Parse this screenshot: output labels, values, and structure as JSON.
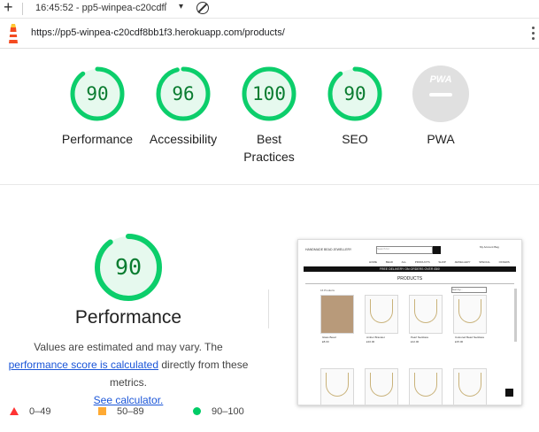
{
  "topbar": {
    "plus": "+",
    "title": "16:45:52 - pp5-winpea-c20cdfẛ",
    "caret": "▾"
  },
  "urlbar": {
    "url": "https://pp5-winpea-c20cdf8bb1f3.herokuapp.com/products/"
  },
  "categories": [
    {
      "score": "90",
      "label": "Performance",
      "value": 0.9
    },
    {
      "score": "96",
      "label": "Accessibility",
      "value": 0.96
    },
    {
      "score": "100",
      "label": "Best Practices",
      "value": 1.0
    },
    {
      "score": "90",
      "label": "SEO",
      "value": 0.9
    }
  ],
  "pwa": {
    "label": "PWA",
    "badge": "PWA"
  },
  "performance": {
    "score": "90",
    "value": 0.9,
    "title": "Performance",
    "desc_1": "Values are estimated and may vary. The",
    "link_1": "performance score is calculated",
    "desc_2": "directly from these metrics.",
    "link_2": "See calculator."
  },
  "legend": {
    "fail": "0–49",
    "average": "50–89",
    "pass": "90–100"
  },
  "colors": {
    "pass": "#0cce6b",
    "pass_text": "#0a7c30",
    "pass_bg": "#e6f9ee",
    "average": "#ffaa33",
    "fail": "#ff3333"
  },
  "thumbnail": {
    "brand": "HANDMADE BEAD JEWELLERY",
    "search_placeholder": "Search for",
    "icons": "My Account   Bag",
    "nav": "HOME BEAD ALL PRODUCTS SHOP JEWELLERY SPECIAL OFFERS",
    "banner": "FREE DELIVERY ON ORDERS OVER £50!",
    "heading": "PRODUCTS",
    "count": "16 Products",
    "sort": "Sort by...",
    "items": [
      {
        "name": "Glass Bead",
        "price": "£8.00"
      },
      {
        "name": "Amber Bracelet",
        "price": "£10.00"
      },
      {
        "name": "Pearl Necklace",
        "price": "£12.00"
      },
      {
        "name": "Coloured Bead Necklace",
        "price": "£15.00"
      }
    ]
  }
}
